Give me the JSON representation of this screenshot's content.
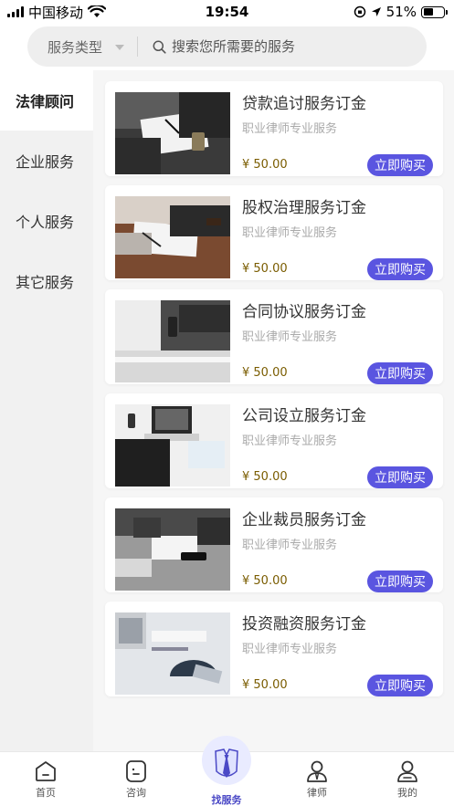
{
  "status_bar": {
    "carrier": "中国移动",
    "time": "19:54",
    "battery": "51%",
    "battery_level": 0.51
  },
  "search": {
    "type_label": "服务类型",
    "placeholder": "搜索您所需要的服务"
  },
  "categories": [
    {
      "label": "法律顾问",
      "active": true
    },
    {
      "label": "企业服务",
      "active": false
    },
    {
      "label": "个人服务",
      "active": false
    },
    {
      "label": "其它服务",
      "active": false
    }
  ],
  "services": [
    {
      "title": "贷款追讨服务订金",
      "subtitle": "职业律师专业服务",
      "price": "¥ 50.00",
      "button": "立即购买"
    },
    {
      "title": "股权治理服务订金",
      "subtitle": "职业律师专业服务",
      "price": "¥ 50.00",
      "button": "立即购买"
    },
    {
      "title": "合同协议服务订金",
      "subtitle": "职业律师专业服务",
      "price": "¥ 50.00",
      "button": "立即购买"
    },
    {
      "title": "公司设立服务订金",
      "subtitle": "职业律师专业服务",
      "price": "¥ 50.00",
      "button": "立即购买"
    },
    {
      "title": "企业裁员服务订金",
      "subtitle": "职业律师专业服务",
      "price": "¥ 50.00",
      "button": "立即购买"
    },
    {
      "title": "投资融资服务订金",
      "subtitle": "职业律师专业服务",
      "price": "¥ 50.00",
      "button": "立即购买"
    }
  ],
  "tabs": [
    {
      "label": "首页",
      "icon": "home-icon"
    },
    {
      "label": "咨询",
      "icon": "consult-icon"
    },
    {
      "label": "找服务",
      "icon": "tie-icon",
      "active": true
    },
    {
      "label": "律师",
      "icon": "lawyer-icon"
    },
    {
      "label": "我的",
      "icon": "profile-icon"
    }
  ],
  "colors": {
    "accent": "#5a55e0",
    "active_tab": "#4b49c6",
    "price": "#7a5c00"
  }
}
